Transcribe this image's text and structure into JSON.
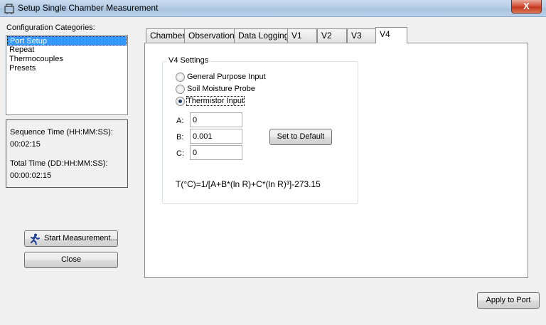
{
  "window": {
    "title": "Setup Single Chamber Measurement",
    "close_label": "X"
  },
  "sidebar": {
    "categories_label": "Configuration Categories:",
    "items": [
      {
        "label": "Port Setup",
        "selected": true
      },
      {
        "label": "Repeat",
        "selected": false
      },
      {
        "label": "Thermocouples",
        "selected": false
      },
      {
        "label": "Presets",
        "selected": false
      }
    ],
    "sequence_time_label": "Sequence Time (HH:MM:SS):",
    "sequence_time_value": "00:02:15",
    "total_time_label": "Total Time (DD:HH:MM:SS):",
    "total_time_value": "00:00:02:15",
    "start_button": "Start Measurement...",
    "close_button": "Close"
  },
  "tabs": [
    {
      "label": "Chamber",
      "active": false
    },
    {
      "label": "Observation",
      "active": false
    },
    {
      "label": "Data Logging",
      "active": false
    },
    {
      "label": "V1",
      "active": false
    },
    {
      "label": "V2",
      "active": false
    },
    {
      "label": "V3",
      "active": false
    },
    {
      "label": "V4",
      "active": true
    }
  ],
  "v4": {
    "group_title": "V4 Settings",
    "options": [
      {
        "label": "General Purpose Input",
        "checked": false
      },
      {
        "label": "Soil Moisture Probe",
        "checked": false
      },
      {
        "label": "Thermistor Input",
        "checked": true
      }
    ],
    "fields": [
      {
        "label": "A:",
        "value": "0"
      },
      {
        "label": "B:",
        "value": "0.001"
      },
      {
        "label": "C:",
        "value": "0"
      }
    ],
    "set_default_button": "Set to Default",
    "formula": "T(°C)=1/[A+B*(ln R)+C*(ln R)³]-273.15"
  },
  "footer": {
    "apply_button": "Apply to Port"
  },
  "colors": {
    "selection": "#3399ff",
    "titlebar": "#b6cde6",
    "close_button": "#c3361d"
  }
}
